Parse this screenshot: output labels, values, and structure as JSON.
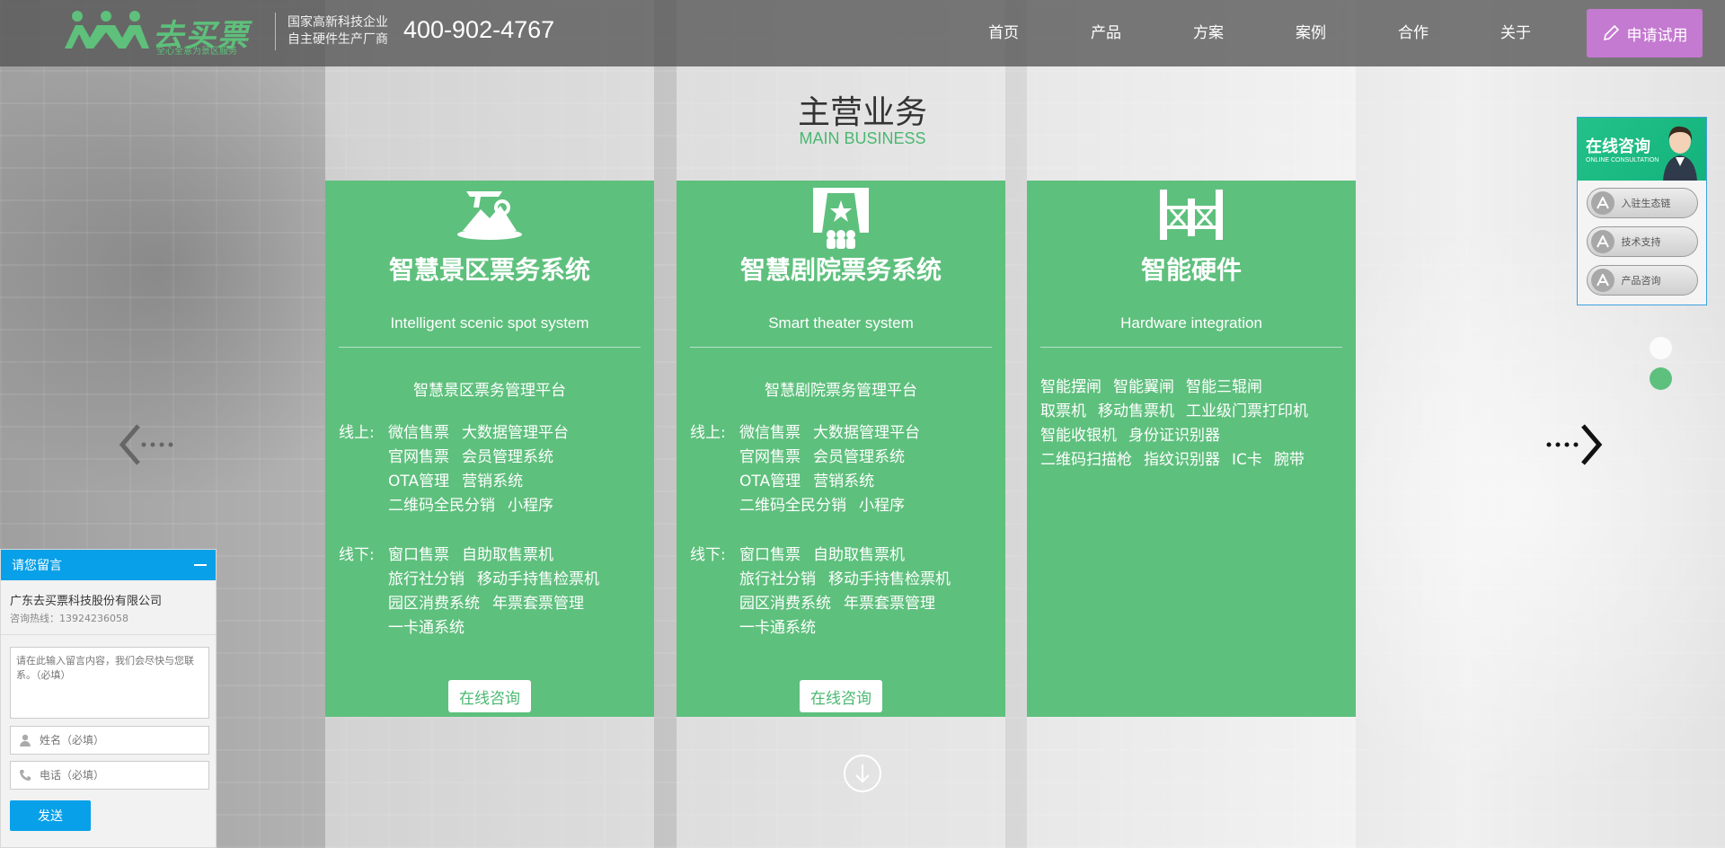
{
  "header": {
    "logo_text": "去买票",
    "logo_slogan": "全心全意为景区服务",
    "tagline_1": "国家高新科技企业",
    "tagline_2": "自主硬件生产厂商",
    "phone": "400-902-4767",
    "nav": [
      "首页",
      "产品",
      "方案",
      "案例",
      "合作",
      "关于"
    ],
    "trial_label": "申请试用"
  },
  "section": {
    "title": "主营业务",
    "subtitle": "MAIN BUSINESS"
  },
  "cards": [
    {
      "icon": "scenic-mountain-icon",
      "title": "智慧景区票务系统",
      "subtitle_en": "Intelligent scenic spot system",
      "platform": "智慧景区票务管理平台",
      "online_label": "线上:",
      "online_rows": [
        [
          "微信售票",
          "大数据管理平台"
        ],
        [
          "官网售票",
          "会员管理系统"
        ],
        [
          "OTA管理",
          "营销系统"
        ],
        [
          "二维码全民分销",
          "小程序"
        ]
      ],
      "offline_label": "线下:",
      "offline_rows": [
        [
          "窗口售票",
          "自助取售票机"
        ],
        [
          "旅行社分销",
          "移动手持售检票机"
        ],
        [
          "园区消费系统",
          "年票套票管理"
        ],
        [
          "一卡通系统"
        ]
      ],
      "button": "在线咨询"
    },
    {
      "icon": "theater-icon",
      "title": "智慧剧院票务系统",
      "subtitle_en": "Smart theater system",
      "platform": "智慧剧院票务管理平台",
      "online_label": "线上:",
      "online_rows": [
        [
          "微信售票",
          "大数据管理平台"
        ],
        [
          "官网售票",
          "会员管理系统"
        ],
        [
          "OTA管理",
          "营销系统"
        ],
        [
          "二维码全民分销",
          "小程序"
        ]
      ],
      "offline_label": "线下:",
      "offline_rows": [
        [
          "窗口售票",
          "自助取售票机"
        ],
        [
          "旅行社分销",
          "移动手持售检票机"
        ],
        [
          "园区消费系统",
          "年票套票管理"
        ],
        [
          "一卡通系统"
        ]
      ],
      "button": "在线咨询"
    },
    {
      "icon": "turnstile-gate-icon",
      "title": "智能硬件",
      "subtitle_en": "Hardware integration",
      "rows": [
        [
          "智能摆闸",
          "智能翼闸",
          "智能三辊闸"
        ],
        [
          "取票机",
          "移动售票机",
          "工业级门票打印机"
        ],
        [
          "智能收银机",
          "身份证识别器"
        ],
        [
          "二维码扫描枪",
          "指纹识别器",
          "IC卡",
          "腕带"
        ]
      ]
    }
  ],
  "consult_widget": {
    "title": "在线咨询",
    "subtitle": "ONLINE CONSULTATION",
    "items": [
      "入驻生态链",
      "技术支持",
      "产品咨询"
    ]
  },
  "message_widget": {
    "title": "请您留言",
    "company": "广东去买票科技股份有限公司",
    "hotline": "咨询热线：13924236058",
    "textarea_placeholder": "请在此输入留言内容，我们会尽快与您联系。（必填）",
    "name_placeholder": "姓名（必填）",
    "phone_placeholder": "电话（必填）",
    "send_label": "发送"
  },
  "colors": {
    "brand_green": "#5ec07d",
    "trial_purple": "#c47ad0",
    "widget_blue": "#08a0e8"
  }
}
